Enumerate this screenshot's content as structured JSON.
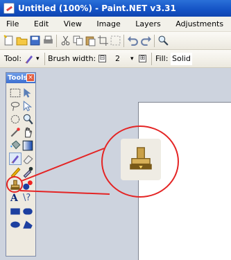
{
  "window": {
    "title": "Untitled (100%) - Paint.NET v3.31",
    "icon": "paint-net-app-icon"
  },
  "menu": {
    "items": [
      "File",
      "Edit",
      "View",
      "Image",
      "Layers",
      "Adjustments"
    ]
  },
  "toolbar": {
    "icons": [
      "new-icon",
      "open-icon",
      "save-icon",
      "print-icon",
      "cut-icon",
      "copy-icon",
      "paste-icon",
      "crop-icon",
      "deselect-icon",
      "undo-icon",
      "redo-icon",
      "zoom-icon"
    ]
  },
  "tool_options": {
    "tool_label": "Tool:",
    "brush_width_label": "Brush width:",
    "brush_width_value": "2",
    "minus_symbol": "⊟",
    "plus_symbol": "⊞",
    "fill_label": "Fill:",
    "fill_value": "Solid"
  },
  "tools_window": {
    "title": "Tools",
    "close_symbol": "×",
    "tools": [
      "rectangle-select-icon",
      "move-selection-icon",
      "lasso-select-icon",
      "move-selected-icon",
      "ellipse-select-icon",
      "zoom-icon",
      "magic-wand-icon",
      "pan-icon",
      "paint-bucket-icon",
      "gradient-icon",
      "paintbrush-icon",
      "eraser-icon",
      "pencil-icon",
      "color-picker-icon",
      "clone-stamp-icon",
      "recolor-icon",
      "text-icon",
      "line-curve-icon",
      "rectangle-icon",
      "rounded-rectangle-icon",
      "ellipse-icon",
      "freeform-shape-icon"
    ],
    "text_tool_glyph": "A",
    "line_tool_glyph": "\\?"
  },
  "callout": {
    "highlighted_tool": "clone-stamp-icon",
    "color": "#e42424"
  }
}
